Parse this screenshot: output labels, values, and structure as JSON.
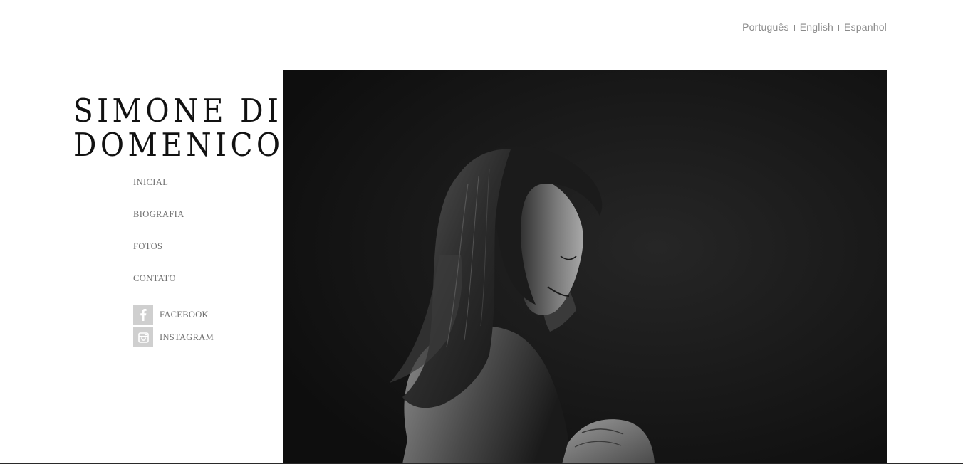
{
  "languages": [
    "Português",
    "English",
    "Espanhol"
  ],
  "site_title": {
    "line1": "SIMONE DI",
    "line2": "DOMENICO"
  },
  "nav": {
    "items": [
      "INICIAL",
      "BIOGRAFIA",
      "FOTOS",
      "CONTATO"
    ]
  },
  "social": {
    "facebook": {
      "label": "FACEBOOK",
      "icon": "facebook-icon"
    },
    "instagram": {
      "label": "INSTAGRAM",
      "icon": "instagram-icon"
    }
  },
  "colors": {
    "text_gray": "#707070",
    "icon_bg": "#cfcfcf",
    "title": "#111111",
    "photo_bg": "#111111"
  }
}
